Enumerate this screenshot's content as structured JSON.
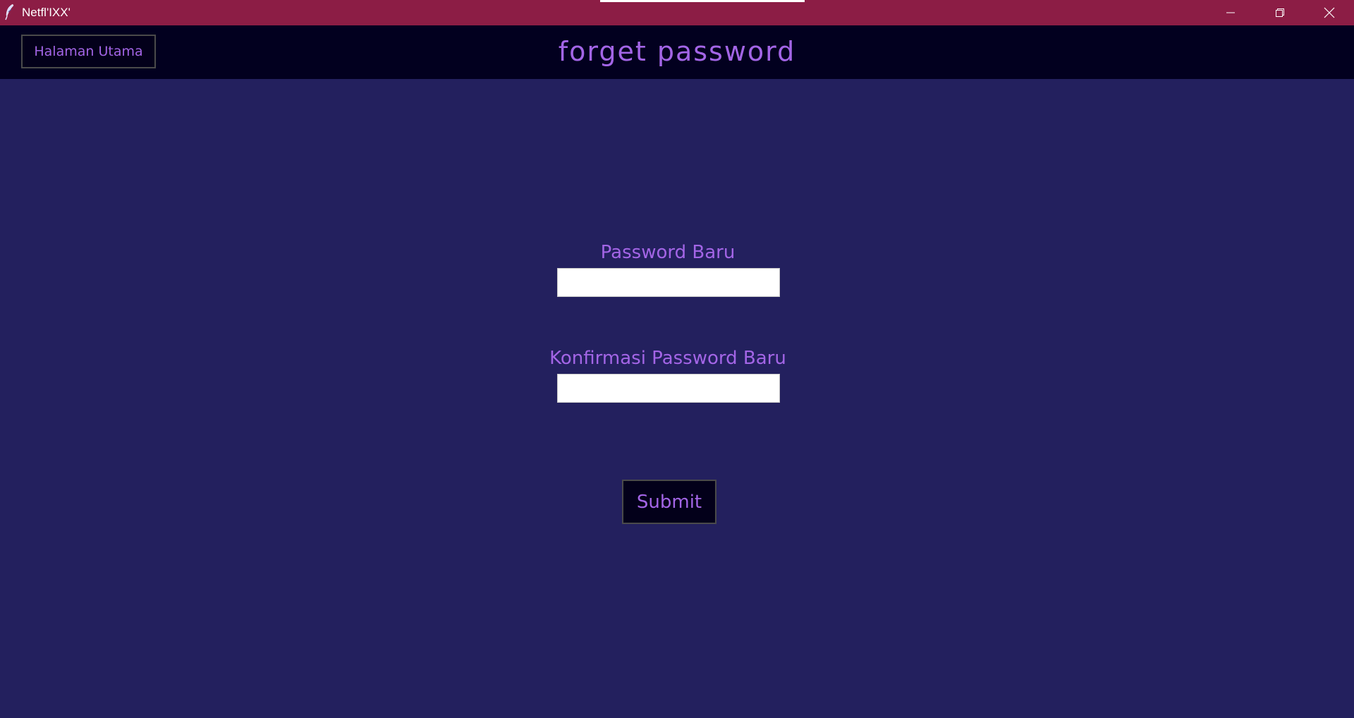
{
  "window": {
    "title": "Netfl'IXX'",
    "icon": "feather-icon",
    "controls": {
      "minimize": "minimize-icon",
      "maximize": "restore-icon",
      "close": "close-icon"
    }
  },
  "header": {
    "home_button_label": "Halaman Utama",
    "title": "forget password"
  },
  "form": {
    "new_password_label": "Password Baru",
    "new_password_value": "",
    "confirm_password_label": "Konfirmasi Password Baru",
    "confirm_password_value": "",
    "submit_label": "Submit"
  },
  "colors": {
    "titlebar": "#8c1d45",
    "header": "#02001f",
    "background": "#23205e",
    "accent_text": "#a365e6",
    "button_bg": "#03001a",
    "input_bg": "#ffffff"
  }
}
